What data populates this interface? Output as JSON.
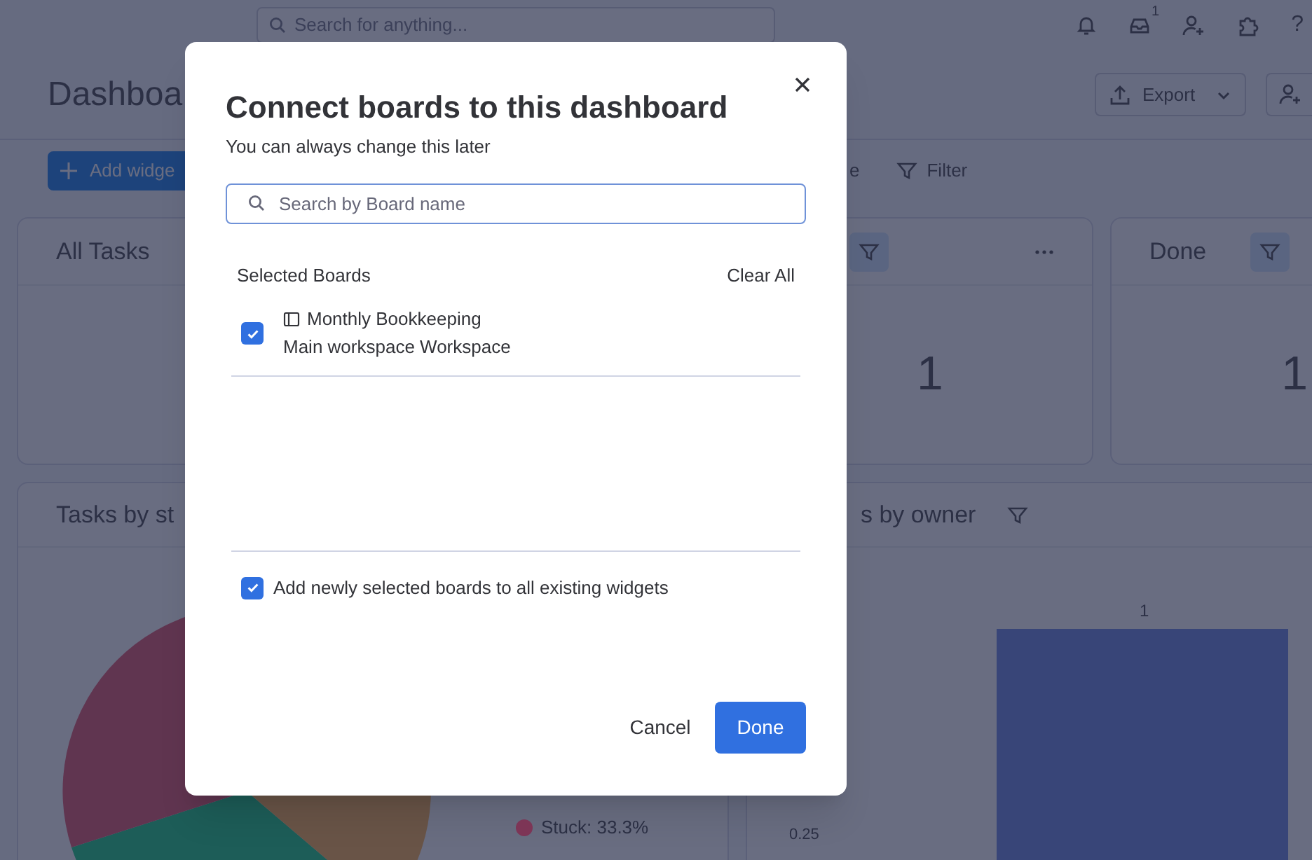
{
  "top_bar": {
    "search": {
      "placeholder": "Search for anything..."
    },
    "inbox_badge": "1",
    "help": "?"
  },
  "page": {
    "title": "Dashboa",
    "export_button": "Export",
    "add_widget_button": "Add widge",
    "toolbar_fragment": "e",
    "filter_button": "Filter"
  },
  "widgets": [
    {
      "title": "All Tasks",
      "filter": false,
      "menu": false
    },
    {
      "value": "1",
      "filter": true,
      "menu": true
    },
    {
      "title": "Done",
      "value": "1",
      "filter": true,
      "menu": false
    }
  ],
  "charts": [
    {
      "kind": "pie",
      "title": "Tasks by st",
      "filter": false,
      "legend": [
        {
          "label": "Stuck: 33.3%",
          "color": "#7d3556"
        }
      ]
    },
    {
      "kind": "bar",
      "title": "s by owner",
      "filter": true,
      "bar_label": "1",
      "y_tick": "0.25"
    }
  ],
  "modal": {
    "title": "Connect boards to this dashboard",
    "subtitle": "You can always change this later",
    "search": {
      "placeholder": "Search by Board name"
    },
    "selected_header": "Selected Boards",
    "clear_all": "Clear All",
    "boards": [
      {
        "name": "Monthly Bookkeeping",
        "workspace": "Main workspace Workspace",
        "checked": true
      }
    ],
    "add_to_widgets": {
      "label": "Add newly selected boards to all existing widgets",
      "checked": true
    },
    "buttons": [
      {
        "label": "Cancel",
        "kind": "secondary"
      },
      {
        "label": "Done",
        "kind": "primary"
      }
    ]
  }
}
